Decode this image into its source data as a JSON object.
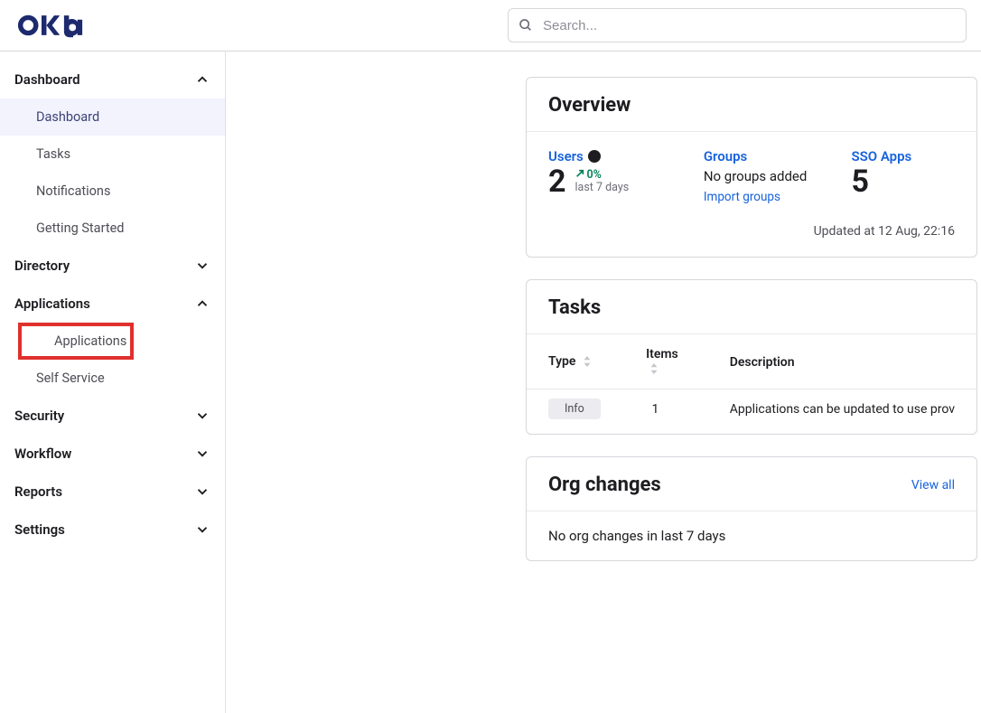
{
  "brand": "okta",
  "search": {
    "placeholder": "Search..."
  },
  "sidebar": {
    "sections": [
      {
        "label": "Dashboard",
        "expanded": true,
        "items": [
          {
            "label": "Dashboard",
            "active": true
          },
          {
            "label": "Tasks"
          },
          {
            "label": "Notifications"
          },
          {
            "label": "Getting Started"
          }
        ]
      },
      {
        "label": "Directory",
        "expanded": false
      },
      {
        "label": "Applications",
        "expanded": true,
        "items": [
          {
            "label": "Applications",
            "highlighted": true
          },
          {
            "label": "Self Service"
          }
        ]
      },
      {
        "label": "Security",
        "expanded": false
      },
      {
        "label": "Workflow",
        "expanded": false
      },
      {
        "label": "Reports",
        "expanded": false
      },
      {
        "label": "Settings",
        "expanded": false
      }
    ]
  },
  "overview": {
    "title": "Overview",
    "users": {
      "label": "Users",
      "count": "2",
      "trend_pct": "0%",
      "trend_period": "last 7 days"
    },
    "groups": {
      "label": "Groups",
      "text": "No groups added",
      "link": "Import groups"
    },
    "sso": {
      "label": "SSO Apps",
      "count": "5"
    },
    "updated": "Updated at 12 Aug, 22:16"
  },
  "tasks": {
    "title": "Tasks",
    "columns": {
      "type": "Type",
      "items": "Items",
      "description": "Description"
    },
    "rows": [
      {
        "type": "Info",
        "items": "1",
        "description": "Applications can be updated to use prov"
      }
    ]
  },
  "org_changes": {
    "title": "Org changes",
    "view_all": "View all",
    "empty_text": "No org changes in last 7 days"
  }
}
